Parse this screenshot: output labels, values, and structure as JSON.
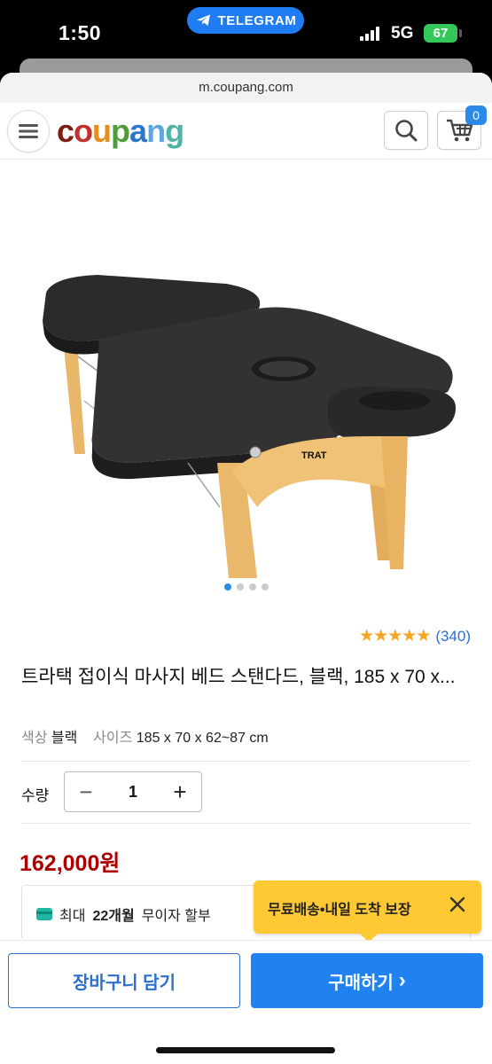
{
  "status_bar": {
    "time": "1:50",
    "app_pill": "TELEGRAM",
    "network": "5G",
    "battery": "67"
  },
  "browser": {
    "url": "m.coupang.com"
  },
  "header": {
    "logo_letters": [
      "c",
      "o",
      "u",
      "p",
      "a",
      "n",
      "g"
    ],
    "cart_count": "0"
  },
  "gallery": {
    "image_alt": "folding massage bed",
    "dot_count": 4,
    "active_dot": 0
  },
  "product": {
    "stars": "★★★★★",
    "rating_value": 4.5,
    "review_count": "(340)",
    "title": "트라택 접이식 마사지 베드 스탠다드, 블랙, 185 x 70 x...",
    "option_color_key": "색상",
    "option_color_value": "블랙",
    "option_size_key": "사이즈",
    "option_size_value": "185 x 70 x 62~87 cm",
    "qty_label": "수량",
    "qty_value": "1",
    "qty_minus": "−",
    "qty_plus": "+",
    "price": "162,000원"
  },
  "installment": {
    "prefix": "최대",
    "months": "22개월",
    "suffix": "무이자 할부"
  },
  "tooltip": {
    "text": "무료배송•내일 도착 보장"
  },
  "actions": {
    "add_to_cart": "장바구니 담기",
    "buy": "구매하기",
    "buy_arrow": "›"
  },
  "colors": {
    "accent": "#1f82f0",
    "price": "#ae0000",
    "tooltip": "#ffc933",
    "stars": "#f5a524"
  }
}
